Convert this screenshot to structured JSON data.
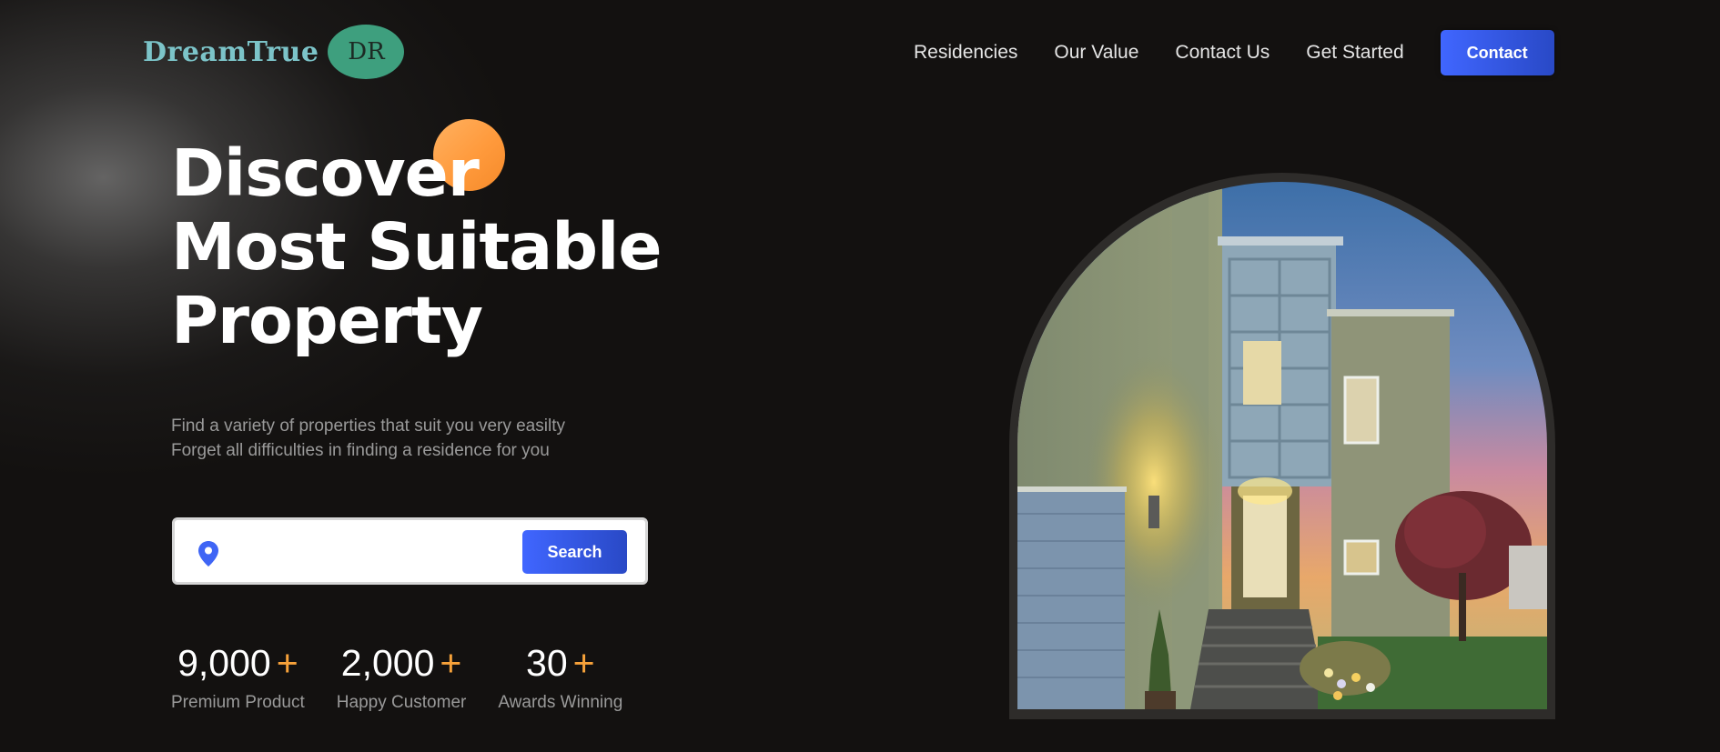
{
  "header": {
    "logo_text": "DreamTrue",
    "logo_badge": "DR",
    "nav": [
      "Residencies",
      "Our Value",
      "Contact Us",
      "Get Started"
    ],
    "contact_button": "Contact"
  },
  "hero": {
    "title_lines": [
      "Discover",
      "Most Suitable",
      "Property"
    ],
    "description_lines": [
      "Find a variety of properties that suit you very easilty",
      "Forget all difficulties in finding a residence for you"
    ],
    "search": {
      "placeholder": "",
      "value": "",
      "button_label": "Search",
      "icon": "location-pin-icon"
    },
    "stats": [
      {
        "number": "9,000",
        "suffix": "+",
        "label": "Premium Product"
      },
      {
        "number": "2,000",
        "suffix": "+",
        "label": "Happy Customer"
      },
      {
        "number": "30",
        "suffix": "+",
        "label": "Awards Winning"
      }
    ]
  },
  "colors": {
    "background": "#131110",
    "accent_blue": "#4066ff",
    "accent_orange": "#f7a23a",
    "logo_teal": "#7cc4c9",
    "logo_badge_green": "#3e9f7e",
    "muted_text": "#9a9a9a"
  }
}
